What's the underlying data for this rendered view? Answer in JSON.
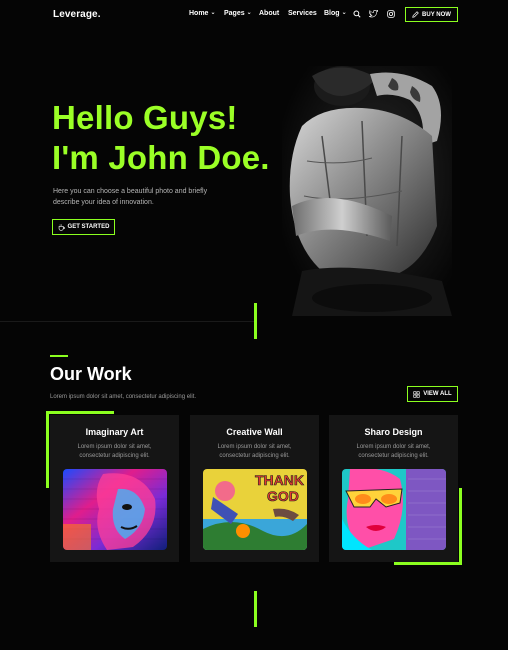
{
  "header": {
    "logo": "Leverage.",
    "nav": [
      {
        "label": "Home",
        "dropdown": true
      },
      {
        "label": "Pages",
        "dropdown": true
      },
      {
        "label": "About",
        "dropdown": false
      },
      {
        "label": "Services",
        "dropdown": false
      },
      {
        "label": "Blog",
        "dropdown": true
      }
    ],
    "buy_label": "BUY NOW"
  },
  "hero": {
    "title_line1": "Hello Guys!",
    "title_line2": "I'm John Doe.",
    "description": "Here you can choose a beautiful photo and briefly describe your idea of innovation.",
    "cta_label": "GET STARTED"
  },
  "work": {
    "title": "Our Work",
    "subtitle": "Lorem ipsum dolor sit amet, consectetur adipiscing elit.",
    "view_all_label": "VIEW ALL",
    "cards": [
      {
        "title": "Imaginary Art",
        "desc_line1": "Lorem ipsum dolor sit amet,",
        "desc_line2": "consectetur adipiscing elit."
      },
      {
        "title": "Creative Wall",
        "desc_line1": "Lorem ipsum dolor sit amet,",
        "desc_line2": "consectetur adipiscing elit."
      },
      {
        "title": "Sharo Design",
        "desc_line1": "Lorem ipsum dolor sit amet,",
        "desc_line2": "consectetur adipiscing elit."
      }
    ],
    "graffiti_text": {
      "line1": "THANK",
      "line2": "GOD"
    }
  },
  "colors": {
    "accent": "#8bff1f",
    "title": "#9bff26",
    "background": "#050505",
    "card": "#151515"
  },
  "icons": [
    "chevron-down-icon",
    "search-icon",
    "twitter-icon",
    "instagram-icon",
    "pencil-icon",
    "coffee-icon",
    "grid-icon"
  ]
}
